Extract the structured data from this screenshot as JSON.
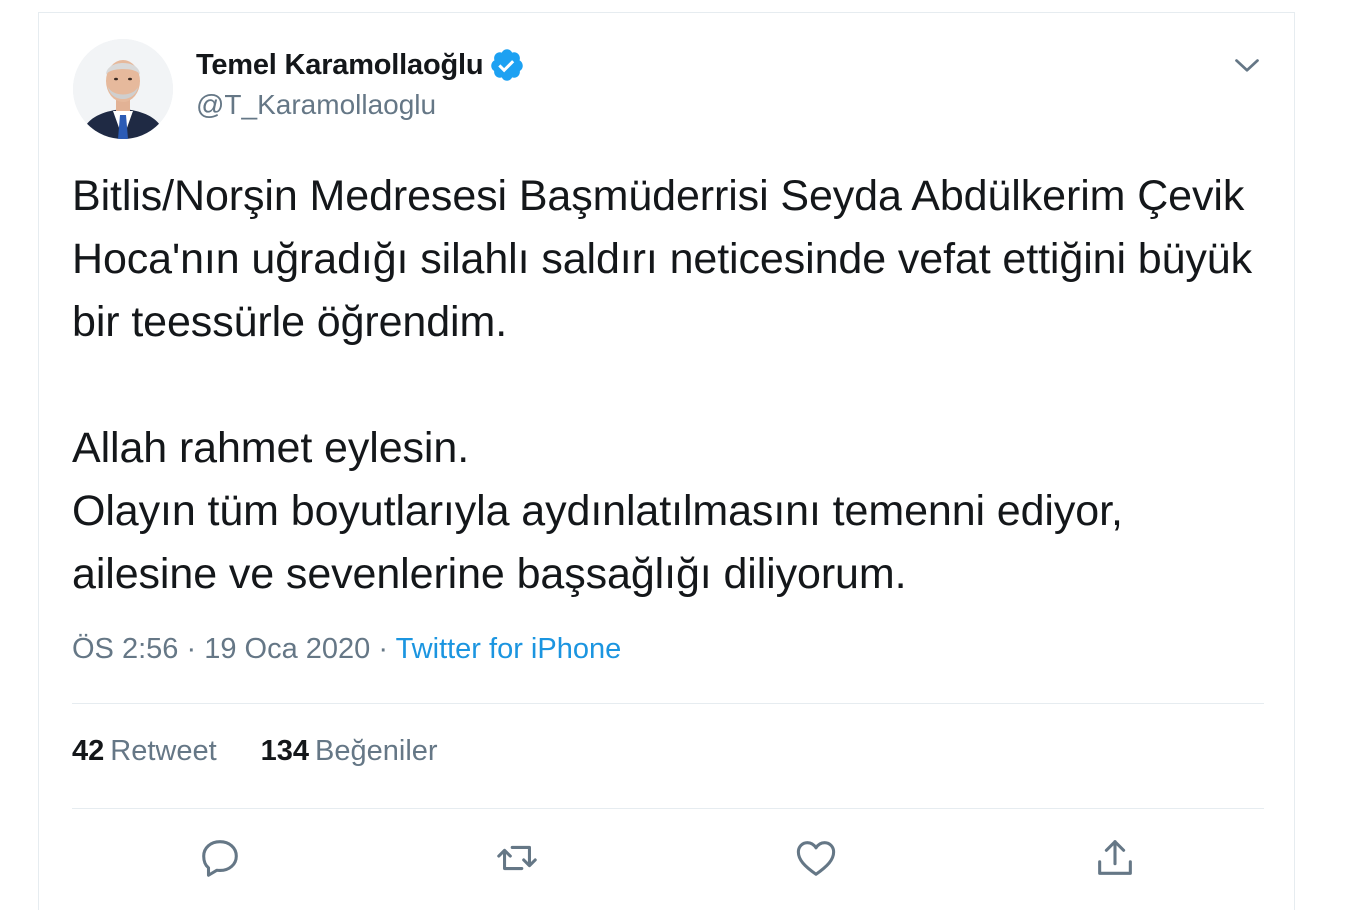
{
  "user": {
    "name": "Temel Karamollaoğlu",
    "handle": "@T_Karamollaoglu"
  },
  "tweet": {
    "paragraphs": [
      "Bitlis/Norşin Medresesi Başmüderrisi Seyda Abdülkerim Çevik Hoca'nın uğradığı silahlı saldırı neticesinde vefat ettiğini büyük bir teessürle öğrendim.",
      "Allah rahmet eylesin.",
      "Olayın tüm boyutlarıyla aydınlatılmasını temenni ediyor, ailesine ve sevenlerine başsağlığı diliyorum."
    ]
  },
  "meta": {
    "time": "ÖS 2:56",
    "separator": "·",
    "date": "19 Oca 2020",
    "source": "Twitter for iPhone"
  },
  "stats": {
    "retweets_count": "42",
    "retweets_label": "Retweet",
    "likes_count": "134",
    "likes_label": "Beğeniler"
  },
  "icons": {
    "verified": "verified-badge-icon",
    "menu": "chevron-down-icon",
    "reply": "reply-icon",
    "retweet": "retweet-icon",
    "like": "heart-icon",
    "share": "share-icon"
  },
  "colors": {
    "text": "#14171a",
    "secondary": "#657786",
    "link": "#1b95e0",
    "verified": "#1da1f2",
    "divider": "#e6ecf0"
  }
}
